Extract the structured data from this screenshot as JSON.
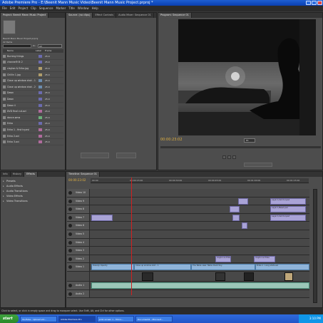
{
  "window": {
    "title": "Adobe Premiere Pro - E:\\Beenit Mann Music Video\\Beenit Mann Music Project.prproj *"
  },
  "menu": [
    "File",
    "Edit",
    "Project",
    "Clip",
    "Sequence",
    "Marker",
    "Title",
    "Window",
    "Help"
  ],
  "project_panel": {
    "tab": "Project: Beenit Mann Music Project",
    "project_name": "Beenit Mann Music Project.prproj",
    "items_count": "22 Items",
    "in_label": "In:",
    "in_value": "All",
    "columns": [
      "Name",
      "Label",
      "Frame"
    ],
    "items": [
      {
        "name": "Burning things",
        "rate": "25.0"
      },
      {
        "name": "channel9 lit 2",
        "rate": "25.0"
      },
      {
        "name": "clayton & Erika.jpg",
        "rate": "25.0"
      },
      {
        "name": "Chillin 1.jpg",
        "rate": "25.0"
      },
      {
        "name": "Close up window shot - 1",
        "rate": "25.0"
      },
      {
        "name": "Close up window shot - 2",
        "rate": "25.0"
      },
      {
        "name": "Dawn",
        "rate": "25.0"
      },
      {
        "name": "Dawn",
        "rate": "25.0"
      },
      {
        "name": "Dawn ii",
        "rate": "25.0"
      },
      {
        "name": "DVD final cut.avi",
        "rate": "25.0"
      },
      {
        "name": "dance.wma",
        "rate": "25.0"
      },
      {
        "name": "Erika",
        "rate": "25.0"
      },
      {
        "name": "Erika 1 - first try.avi",
        "rate": "25.0"
      },
      {
        "name": "Erika 2.avi",
        "rate": "25.0"
      },
      {
        "name": "Erika 3.avi",
        "rate": "25.0"
      }
    ]
  },
  "source_panel": {
    "tabs": [
      "Source: (no clips)",
      "Effect Controls",
      "Audio Mixer: Sequence 01"
    ]
  },
  "program_panel": {
    "tab": "Program: Sequence 01",
    "timecode": "00:00:23:02",
    "zoom": "Fit"
  },
  "effects_panel": {
    "tabs": [
      "Info",
      "History",
      "Effects"
    ],
    "items": [
      "Presets",
      "Audio Effects",
      "Audio Transitions",
      "Video Effects",
      "Video Transitions"
    ]
  },
  "timeline": {
    "tab": "Timeline: Sequence 01",
    "timecode": "00:00:23:02",
    "ruler_labels": [
      "00:00",
      "00:00:15:00",
      "00:00:30:00",
      "00:00:45:00",
      "00:01:00:00",
      "00:01:15:00"
    ],
    "tracks": [
      {
        "name": "Video 10"
      },
      {
        "name": "Video 9"
      },
      {
        "name": "Video 8"
      },
      {
        "name": "Video 7"
      },
      {
        "name": "Video 6"
      },
      {
        "name": "Video 5"
      },
      {
        "name": "Video 4"
      },
      {
        "name": "Video 3"
      },
      {
        "name": "Video 2"
      },
      {
        "name": "Video 1"
      },
      {
        "name": "Audio 1"
      },
      {
        "name": "Audio 2"
      }
    ],
    "clips": {
      "v9_a": "Layer 1/red hor.psd",
      "v8_a": "Layer 1/Read.psd",
      "v7_a": "Layer 1/red hor.psd",
      "v2_a": "clayton & Erika",
      "v2_b": "clayton & Erika",
      "v1_a": "Dawn/p Opacity",
      "v1_b": "Close up window shot - 1",
      "v1_c": "The Table view: Table check tiny",
      "v1_d": "Erika 1 - Long shots.avi"
    }
  },
  "status": "Click to select, or click in empty space and drag to marquee select. Use Shift, Alt, and Ctrl for other options.",
  "taskbar": {
    "start": "start",
    "tasks": [
      "YouTube - Upload vid...",
      "Adobe Premiere Pro",
      "pink screen 1 - Micro...",
      "Document2 - Microsof..."
    ],
    "clock": "3:10 PM"
  }
}
